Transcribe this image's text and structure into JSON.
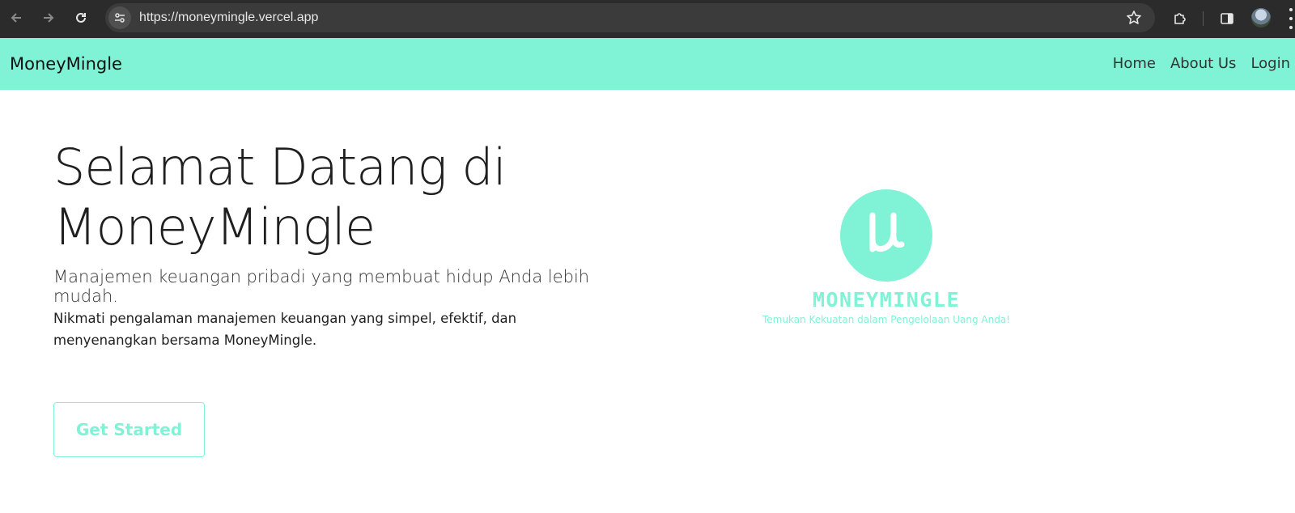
{
  "browser": {
    "url": "https://moneymingle.vercel.app"
  },
  "navbar": {
    "brand": "MoneyMingle",
    "links": [
      "Home",
      "About Us",
      "Login"
    ]
  },
  "hero": {
    "title_line1": "Selamat Datang di",
    "title_line2": "MoneyMingle",
    "lead": "Manajemen keuangan pribadi yang membuat hidup Anda lebih mudah.",
    "text": "Nikmati pengalaman manajemen keuangan yang simpel, efektif, dan menyenangkan bersama MoneyMingle.",
    "cta": "Get Started"
  },
  "logo": {
    "wordmark": "MONEYMINGLE",
    "tagline": "Temukan Kekuatan dalam Pengelolaan Uang Anda!",
    "symbol": "μ"
  },
  "colors": {
    "accent": "#80f3d6",
    "chrome": "#2b2b2b"
  }
}
